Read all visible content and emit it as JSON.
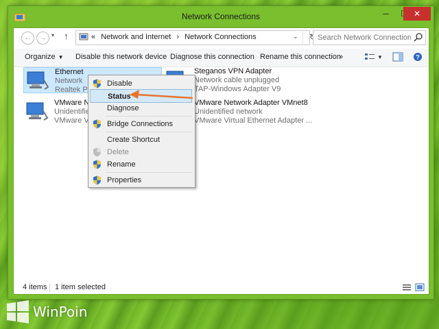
{
  "window": {
    "title": "Network Connections",
    "minimize_glyph": "─",
    "maximize_glyph": "☐",
    "close_glyph": "✕"
  },
  "address_bar": {
    "back_glyph": "←",
    "forward_glyph": "→",
    "recent_glyph": "▾",
    "up_glyph": "↑",
    "path_prefix": "«",
    "path": [
      "Network and Internet",
      "Network Connections"
    ],
    "path_separator": "›",
    "dropdown_glyph": "⌄",
    "refresh_glyph": "↻",
    "search_placeholder": "Search Network Connections"
  },
  "command_bar": {
    "organize": "Organize",
    "disable": "Disable this network device",
    "diagnose": "Diagnose this connection",
    "rename": "Rename this connection",
    "more_glyph": "»",
    "view_dropdown_glyph": "▼"
  },
  "connections": [
    {
      "name": "Ethernet",
      "status": "Network",
      "device": "Realtek PCIe",
      "selected": true
    },
    {
      "name": "Steganos VPN Adapter",
      "status": "Network cable unplugged",
      "device": "TAP-Windows Adapter V9",
      "selected": false
    },
    {
      "name": "VMware Netw",
      "status": "Unidentified",
      "device": "VMware Virtu",
      "selected": false
    },
    {
      "name": "VMware Network Adapter VMnet8",
      "status": "Unidentified network",
      "device": "VMware Virtual Ethernet Adapter ...",
      "selected": false
    }
  ],
  "context_menu": {
    "disable": "Disable",
    "status": "Status",
    "diagnose": "Diagnose",
    "bridge": "Bridge Connections",
    "shortcut": "Create Shortcut",
    "delete": "Delete",
    "rename": "Rename",
    "properties": "Properties"
  },
  "status_bar": {
    "item_count": "4 items",
    "selection": "1 item selected"
  },
  "watermark": {
    "text": "WinPoin"
  },
  "colors": {
    "accent_arrow": "#e8742a",
    "selection": "#cce8ff",
    "close_button": "#c7302c",
    "desktop_green": "#74b82b"
  }
}
